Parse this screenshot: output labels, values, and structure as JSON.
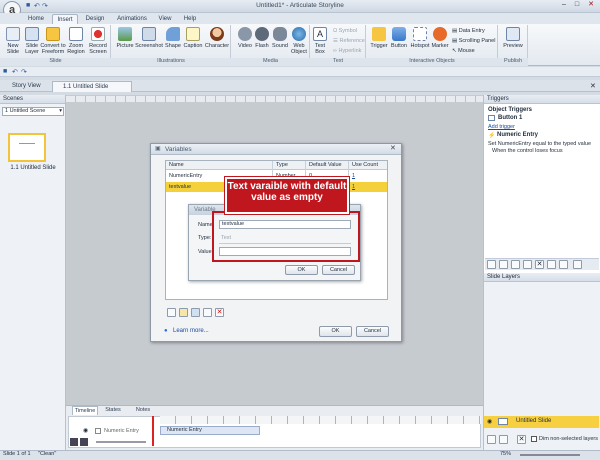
{
  "app": {
    "title": "Untitled1* - Articulate Storyline",
    "logo_letter": "a"
  },
  "ribbon": {
    "tabs": [
      "Home",
      "Insert",
      "Design",
      "Animations",
      "View",
      "Help"
    ],
    "active_tab": "Insert",
    "slide_group": {
      "label": "Slide",
      "buttons": [
        "New Slide",
        "Slide Layer",
        "Convert to Freeform",
        "Zoom Region",
        "Record Screen"
      ]
    },
    "illustrations_group": {
      "label": "Illustrations",
      "buttons": [
        "Picture",
        "Screenshot",
        "Shape",
        "Caption",
        "Character"
      ]
    },
    "media_group": {
      "label": "Media",
      "buttons": [
        "Video",
        "Flash",
        "Sound",
        "Web Object"
      ]
    },
    "text_group": {
      "label": "Text",
      "buttons": [
        "Text Box"
      ],
      "small": [
        "Symbol",
        "Reference",
        "Hyperlink"
      ]
    },
    "interactive_group": {
      "label": "Interactive Objects",
      "buttons": [
        "Trigger",
        "Button",
        "Hotspot",
        "Marker"
      ],
      "small": [
        "Data Entry",
        "Scrolling Panel",
        "Mouse"
      ]
    },
    "publish_group": {
      "label": "Publish",
      "buttons": [
        "Preview"
      ]
    }
  },
  "doc_tabs": [
    "Story View",
    "1.1 Untitled Slide"
  ],
  "scenes": {
    "header": "Scenes",
    "selected_scene": "1 Untitled Scene",
    "slide_label": "1.1 Untitled Slide"
  },
  "variables_dialog": {
    "title": "Variables",
    "columns": [
      "Name",
      "Type",
      "Default Value",
      "Use Count"
    ],
    "rows": [
      {
        "name": "NumericEntry",
        "type": "Number",
        "default": "0",
        "count": "1"
      },
      {
        "name": "textvalue",
        "type": "Text",
        "default": "",
        "count": "1"
      }
    ],
    "learn_more": "Learn more...",
    "ok": "OK",
    "cancel": "Cancel"
  },
  "variable_subdialog": {
    "title": "Variable",
    "name_label": "Name:",
    "name_value": "textvalue",
    "type_label": "Type:",
    "type_value": "Text",
    "value_label": "Value:",
    "value_value": "",
    "ok": "OK",
    "cancel": "Cancel"
  },
  "callout": {
    "text": "Text varaible with default value as empty",
    "color": "#c0171e"
  },
  "triggers": {
    "header": "Triggers",
    "section": "Object Triggers",
    "object": "Button 1",
    "add_trigger": "Add trigger",
    "trigger_name": "Numeric Entry",
    "trigger_desc": "Set NumericEntry equal to the typed value",
    "trigger_when": "When the control loses focus"
  },
  "slide_layers": {
    "header": "Slide Layers",
    "layer_name": "Untitled Slide",
    "dim_label": "Dim non-selected layers"
  },
  "timeline": {
    "tabs": [
      "Timeline",
      "States",
      "Notes"
    ],
    "active": "Timeline",
    "row_label": "Numeric Entry",
    "row_label2": "Numeric Entry"
  },
  "status": {
    "slide": "Slide 1 of 1",
    "state": "\"Clean\"",
    "zoom": "75%"
  }
}
